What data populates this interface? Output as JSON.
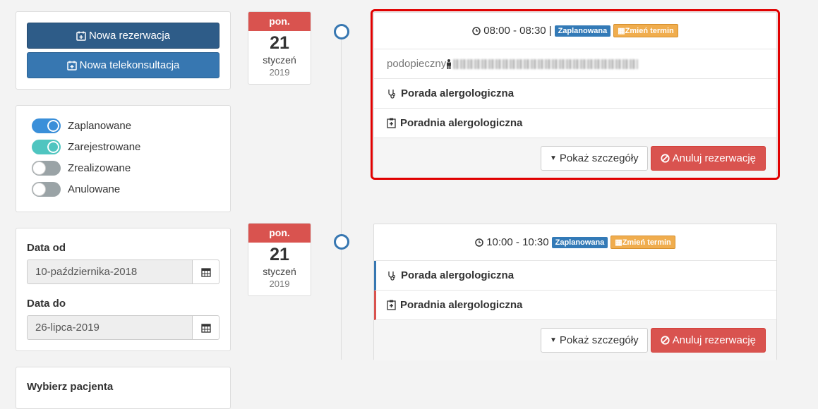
{
  "sidebar": {
    "new_reservation": "Nowa rezerwacja",
    "new_teleconsultation": "Nowa telekonsultacja",
    "filters": [
      {
        "label": "Zaplanowane",
        "on": true,
        "color": "#3a8fd9"
      },
      {
        "label": "Zarejestrowane",
        "on": true,
        "color": "#4fc5c0"
      },
      {
        "label": "Zrealizowane",
        "on": false,
        "color": "#9aa3a6"
      },
      {
        "label": "Anulowane",
        "on": false,
        "color": "#9aa3a6"
      }
    ],
    "date_from_label": "Data od",
    "date_from_value": "10-października-2018",
    "date_to_label": "Data do",
    "date_to_value": "26-lipca-2019",
    "patient_label": "Wybierz pacjenta"
  },
  "appointments": [
    {
      "date": {
        "dow": "pon.",
        "day": "21",
        "month": "styczeń",
        "year": "2019"
      },
      "time": "08:00 - 08:30",
      "separator": "|",
      "status_badge": "Zaplanowana",
      "change_badge": "Zmień termin",
      "dependent_label": "podopieczny",
      "service": "Porada alergologiczna",
      "clinic": "Poradnia alergologiczna",
      "details_button": "Pokaż szczegóły",
      "cancel_button": "Anuluj rezerwację"
    },
    {
      "date": {
        "dow": "pon.",
        "day": "21",
        "month": "styczeń",
        "year": "2019"
      },
      "time": "10:00 - 10:30",
      "separator": "",
      "status_badge": "Zaplanowana",
      "change_badge": "Zmień termin",
      "service": "Porada alergologiczna",
      "clinic": "Poradnia alergologiczna",
      "details_button": "Pokaż szczegóły",
      "cancel_button": "Anuluj rezerwację"
    }
  ],
  "colors": {
    "primary_dark": "#2e5c88",
    "primary": "#3777b1",
    "danger": "#d9534f",
    "warning": "#f0ad4e",
    "highlight": "#e00000"
  }
}
